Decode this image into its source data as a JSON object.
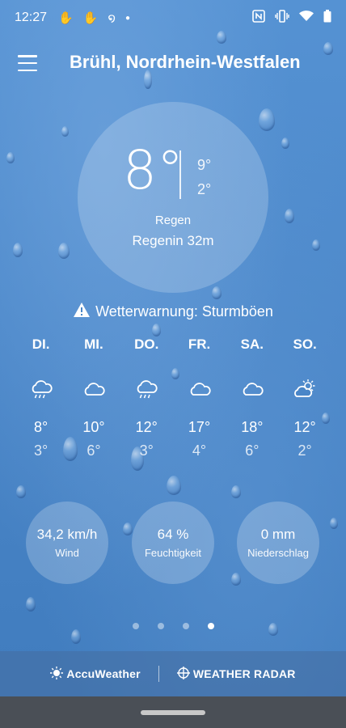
{
  "status_bar": {
    "time": "12:27",
    "left_icons": [
      "hand-icon",
      "hand-icon",
      "spiral-icon",
      "dot-icon"
    ],
    "right_icons": [
      "nfc-icon",
      "vibrate-icon",
      "wifi-icon",
      "battery-icon"
    ]
  },
  "header": {
    "location": "Brühl, Nordrhein-Westfalen"
  },
  "current": {
    "temperature": "8°",
    "high": "9°",
    "low": "2°",
    "condition": "Regen",
    "rain_in": "Regenin 32m"
  },
  "warning": {
    "text": "Wetterwarnung: Sturmböen"
  },
  "forecast": [
    {
      "day": "DI.",
      "icon": "rain-cloud-icon",
      "high": "8°",
      "low": "3°"
    },
    {
      "day": "MI.",
      "icon": "cloud-icon",
      "high": "10°",
      "low": "6°"
    },
    {
      "day": "DO.",
      "icon": "rain-cloud-icon",
      "high": "12°",
      "low": "3°"
    },
    {
      "day": "FR.",
      "icon": "cloud-icon",
      "high": "17°",
      "low": "4°"
    },
    {
      "day": "SA.",
      "icon": "cloud-icon",
      "high": "18°",
      "low": "6°"
    },
    {
      "day": "SO.",
      "icon": "sun-cloud-icon",
      "high": "12°",
      "low": "2°"
    }
  ],
  "details": [
    {
      "value": "34,2 km/h",
      "label": "Wind"
    },
    {
      "value": "64 %",
      "label": "Feuchtigkeit"
    },
    {
      "value": "0 mm",
      "label": "Niederschlag"
    }
  ],
  "pager": {
    "count": 4,
    "active_index": 3
  },
  "footer": {
    "brand1": "AccuWeather",
    "brand2": "WEATHER RADAR"
  },
  "colors": {
    "background": "#4a86c8",
    "text": "#ffffff",
    "navbar": "#4a4f56"
  }
}
